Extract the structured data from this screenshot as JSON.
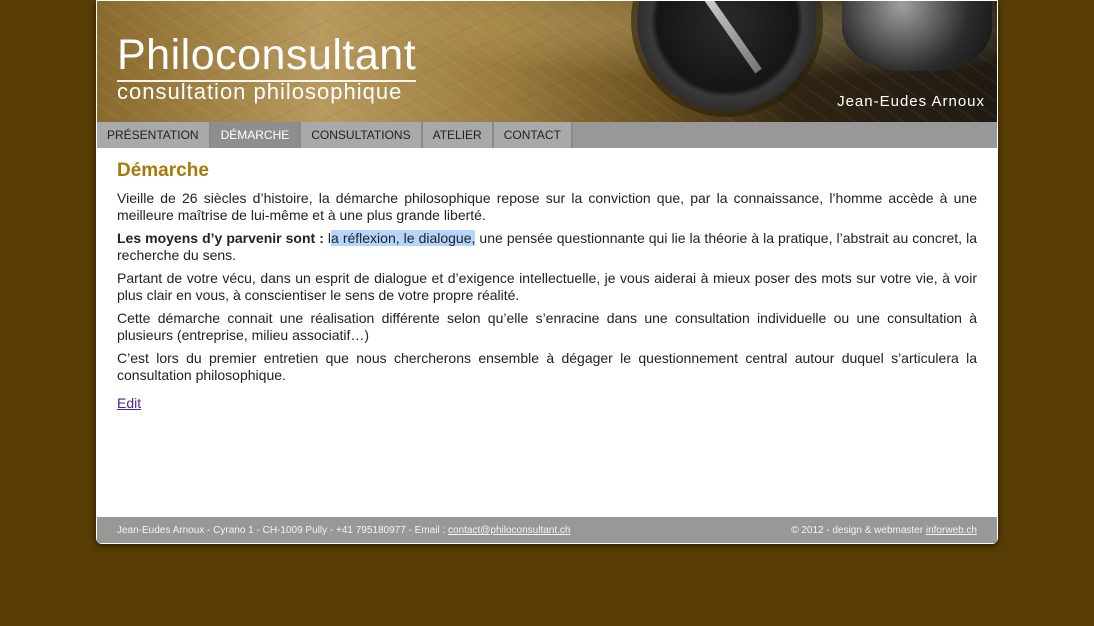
{
  "banner": {
    "title": "Philoconsultant",
    "subtitle": "consultation philosophique",
    "author": "Jean-Eudes Arnoux"
  },
  "nav": {
    "items": [
      {
        "label": "PRÉSENTATION"
      },
      {
        "label": "DÉMARCHE"
      },
      {
        "label": "CONSULTATIONS"
      },
      {
        "label": "ATELIER"
      },
      {
        "label": "CONTACT"
      }
    ],
    "active": "DÉMARCHE"
  },
  "main": {
    "heading": "Démarche",
    "p1": "Vieille de 26 siècles d’histoire, la démarche philosophique repose sur la conviction que, par la connaissance, l’homme accède à une meilleure maîtrise de lui-même  et à une plus grande liberté.",
    "p2_bold": "Les moyens d’y parvenir sont :",
    "p2_pre": " l",
    "p2_highlight": "a réflexion, le dialogue,",
    "p2_rest": " une pensée questionnante qui lie la théorie à la pratique, l’abstrait au concret, la recherche du sens.",
    "p3": "Partant de votre vécu, dans un esprit de dialogue et d’exigence intellectuelle, je vous aiderai à mieux poser des mots sur votre vie, à voir plus clair en vous, à conscientiser le sens de votre propre réalité.",
    "p4": "Cette démarche connait une réalisation différente selon qu’elle s’enracine dans une consultation individuelle ou une consultation à plusieurs (entreprise, milieu associatif…)",
    "p5": "C’est lors du premier entretien que nous chercherons ensemble à dégager le questionnement central autour duquel s’articulera la consultation philosophique.",
    "edit_link": "Edit"
  },
  "footer": {
    "left_text": "Jean-Eudes Arnoux - Cyrano 1 - CH-1009 Pully - +41 795180977 - Email : ",
    "email": "contact@philoconsultant.ch",
    "right_text": "© 2012 - design & webmaster ",
    "webmaster_link": "inforweb.ch"
  },
  "colors": {
    "background": "#573d03",
    "heading": "#a57a08",
    "nav_bar": "#989898",
    "highlight": "#b5d5fd"
  }
}
